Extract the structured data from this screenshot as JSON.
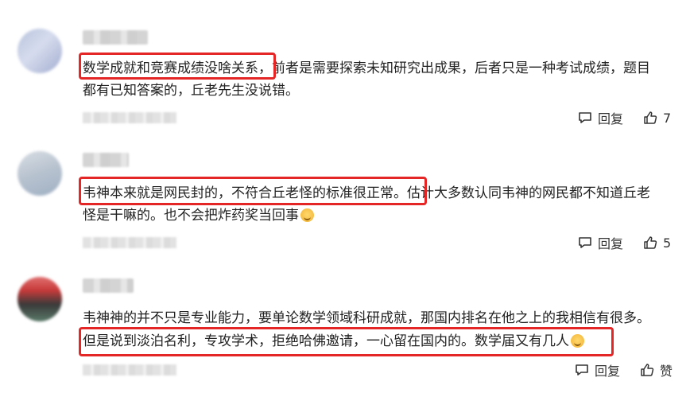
{
  "comments": [
    {
      "text_line1": "数学成就和竞赛成绩没啥关系，前者是需要探索未知研究出成果，后者只是一种考试成绩，题目",
      "text_line2": "都有已知答案的，丘老先生没说错。",
      "reply_label": "回复",
      "like_count": "7"
    },
    {
      "text_line1": "韦神本来就是网民封的，不符合丘老怪的标准很正常。估计大多数认同韦神的网民都不知道丘老",
      "text_line2": "怪是干嘛的。也不会把炸药奖当回事",
      "reply_label": "回复",
      "like_count": "5"
    },
    {
      "text_line1": "韦神神的并不只是专业能力，要单论数学领域科研成就，那国内排名在他之上的我相信有很多。",
      "text_line2": "但是说到淡泊名利，专攻学术，拒绝哈佛邀请，一心留在国内的。数学届又有几人",
      "reply_label": "回复",
      "like_label": "赞"
    }
  ],
  "colors": {
    "highlight": "#e52626",
    "text": "#222222",
    "icon": "#333333"
  },
  "icons": {
    "reply": "comment-bubble-icon",
    "like": "thumbs-up-icon",
    "emoji": "smile-emoji-icon"
  }
}
